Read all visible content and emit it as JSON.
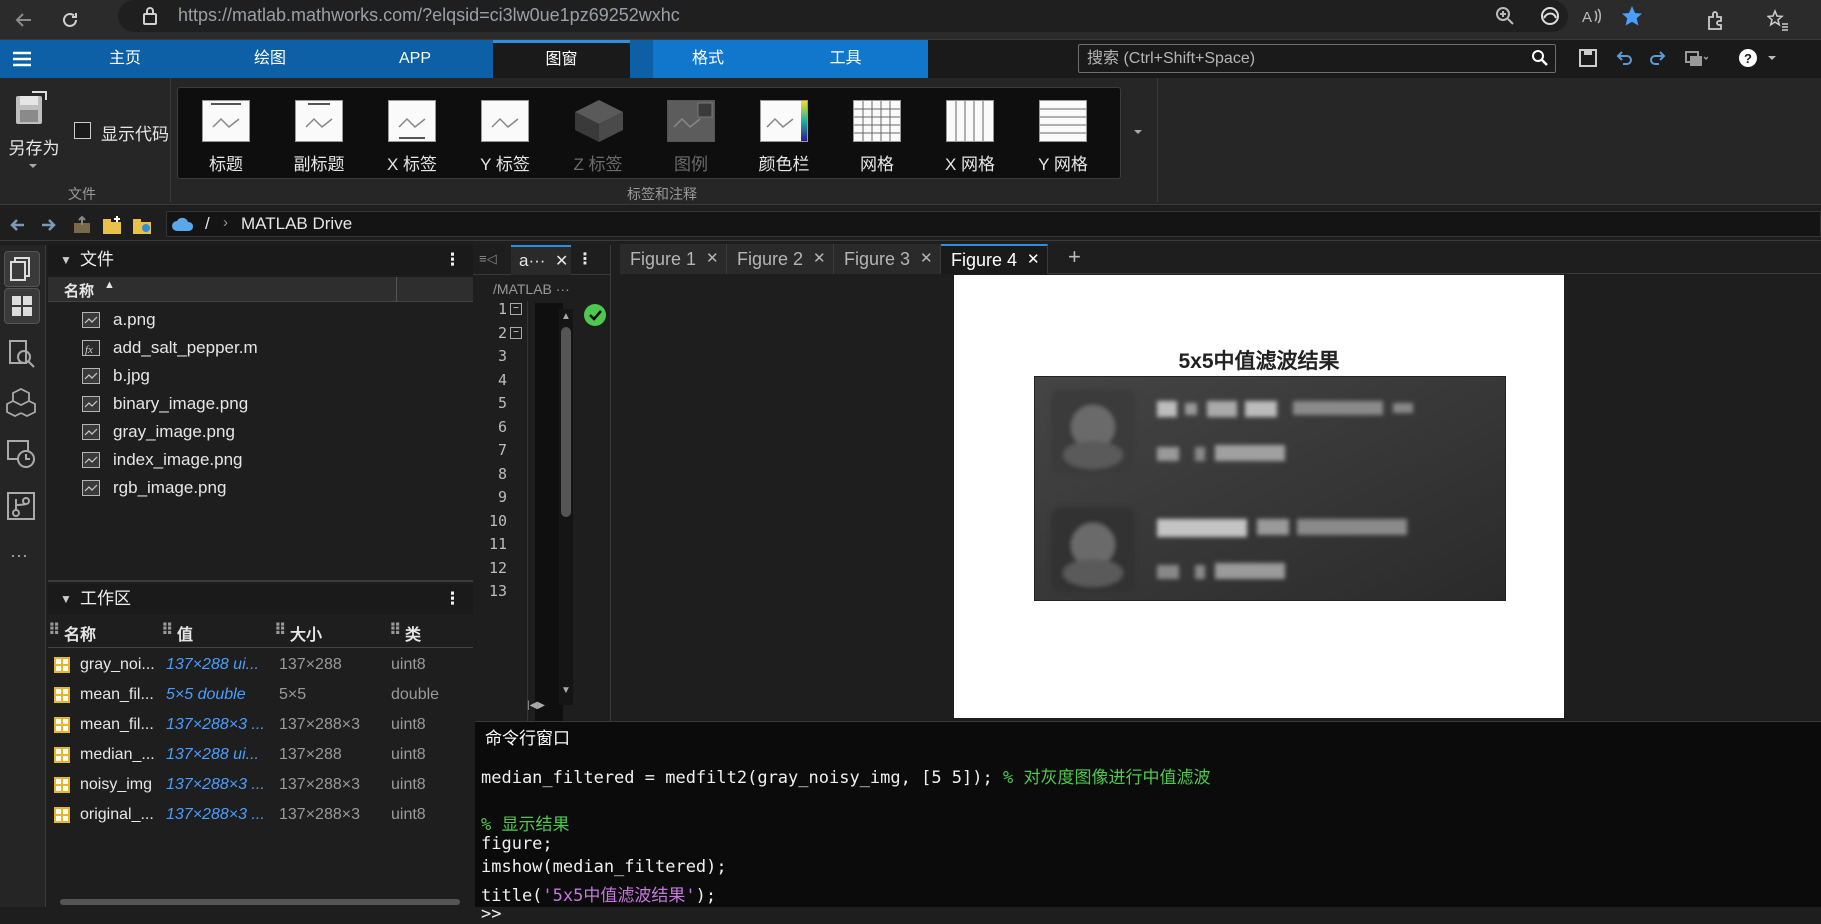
{
  "browser": {
    "url": "https://matlab.mathworks.com/?elqsid=ci3lw0ue1pz69252wxhc"
  },
  "ribbon_tabs": [
    {
      "label": "主页"
    },
    {
      "label": "绘图"
    },
    {
      "label": "APP"
    },
    {
      "label": "图窗"
    },
    {
      "label": "格式"
    },
    {
      "label": "工具"
    }
  ],
  "search": {
    "placeholder": "搜索 (Ctrl+Shift+Space)"
  },
  "file_group": {
    "save_as_label": "另存为",
    "show_code_label": "显示代码",
    "group_label": "文件"
  },
  "annotation_group": {
    "group_label": "标签和注释",
    "buttons": [
      {
        "label": "标题",
        "enabled": true
      },
      {
        "label": "副标题",
        "enabled": true
      },
      {
        "label": "X 标签",
        "enabled": true
      },
      {
        "label": "Y 标签",
        "enabled": true
      },
      {
        "label": "Z 标签",
        "enabled": false
      },
      {
        "label": "图例",
        "enabled": false
      },
      {
        "label": "颜色栏",
        "enabled": true
      },
      {
        "label": "网格",
        "enabled": true
      },
      {
        "label": "X 网格",
        "enabled": true
      },
      {
        "label": "Y 网格",
        "enabled": true
      }
    ]
  },
  "pathbar": {
    "root": "/",
    "folder": "MATLAB Drive"
  },
  "files_panel": {
    "title": "文件",
    "column_name": "名称",
    "files": [
      {
        "name": "a.png",
        "icon": "image-file-icon"
      },
      {
        "name": "add_salt_pepper.m",
        "icon": "function-file-icon"
      },
      {
        "name": "b.jpg",
        "icon": "image-file-icon"
      },
      {
        "name": "binary_image.png",
        "icon": "image-file-icon"
      },
      {
        "name": "gray_image.png",
        "icon": "image-file-icon"
      },
      {
        "name": "index_image.png",
        "icon": "image-file-icon"
      },
      {
        "name": "rgb_image.png",
        "icon": "image-file-icon"
      }
    ]
  },
  "workspace": {
    "title": "工作区",
    "columns": [
      "名称",
      "值",
      "大小",
      "类"
    ],
    "rows": [
      {
        "name": "gray_noi...",
        "value": "137×288 ui...",
        "size": "137×288",
        "class": "uint8"
      },
      {
        "name": "mean_fil...",
        "value": "5×5 double",
        "size": "5×5",
        "class": "double"
      },
      {
        "name": "mean_fil...",
        "value": "137×288×3 ...",
        "size": "137×288×3",
        "class": "uint8"
      },
      {
        "name": "median_...",
        "value": "137×288 ui...",
        "size": "137×288",
        "class": "uint8"
      },
      {
        "name": "noisy_img",
        "value": "137×288×3 ...",
        "size": "137×288×3",
        "class": "uint8"
      },
      {
        "name": "original_...",
        "value": "137×288×3 ...",
        "size": "137×288×3",
        "class": "uint8"
      }
    ]
  },
  "editor": {
    "tab_label": "a···",
    "path": "/MATLAB ···",
    "line_numbers": [
      "1",
      "2",
      "3",
      "4",
      "5",
      "6",
      "7",
      "8",
      "9",
      "10",
      "11",
      "12",
      "13"
    ]
  },
  "figure_tabs": [
    {
      "label": "Figure 1",
      "active": false
    },
    {
      "label": "Figure 2",
      "active": false
    },
    {
      "label": "Figure 3",
      "active": false
    },
    {
      "label": "Figure 4",
      "active": true
    }
  ],
  "figure": {
    "title": "5x5中值滤波结果"
  },
  "command_window": {
    "title": "命令行窗口",
    "lines": [
      {
        "code": "median_filtered = medfilt2(gray_noisy_img, [5 5]); ",
        "comment": "% 对灰度图像进行中值滤波"
      },
      {
        "code": "",
        "comment": ""
      },
      {
        "code": "",
        "comment": "% 显示结果"
      },
      {
        "code": "figure;",
        "comment": ""
      },
      {
        "code": "imshow(median_filtered);",
        "comment": ""
      },
      {
        "code": "title(",
        "string": "'5x5中值滤波结果'",
        "tail": ");"
      },
      {
        "code": ">>",
        "comment": ""
      }
    ]
  },
  "colors": {
    "ribbon_blue": "#0d5fa6",
    "accent": "#2f8ee0",
    "comment_green": "#4ec94e",
    "string_purple": "#c678dd"
  }
}
